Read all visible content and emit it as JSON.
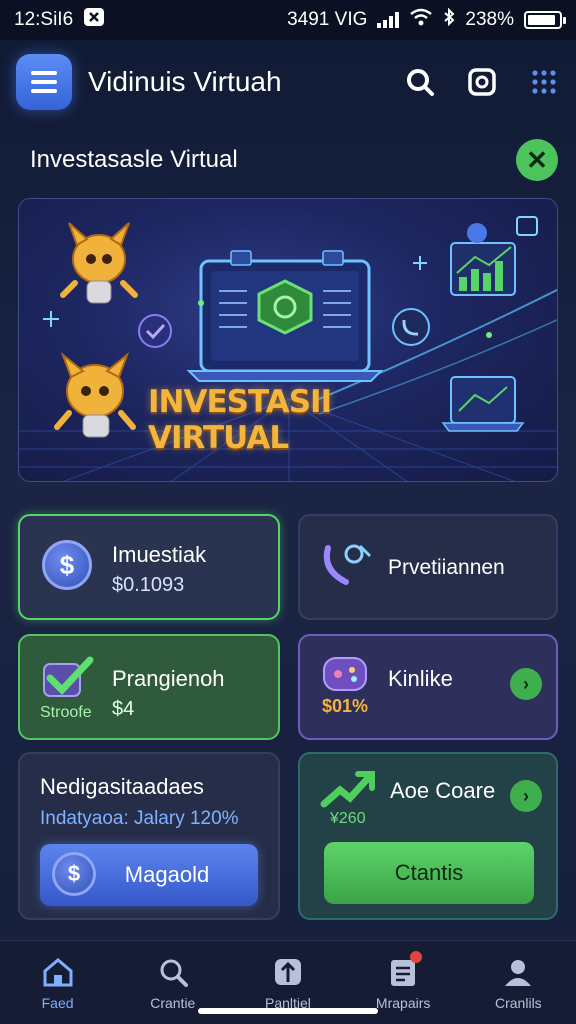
{
  "status": {
    "time": "12:SiI6",
    "network": "3491 VIG",
    "battery": "238%",
    "battery_level": 0.9
  },
  "appbar": {
    "title": "Vidinuis Virtuah",
    "icons": [
      "menu-icon",
      "search-icon",
      "camera-icon",
      "grid-icon"
    ]
  },
  "section": {
    "title": "Investasasle Virtual"
  },
  "banner": {
    "headline": "INVESTASII VIRTUAL"
  },
  "cards": {
    "investment": {
      "label": "Imuestiak",
      "value": "$0.1093"
    },
    "promo": {
      "label": "Prvetiiannen"
    },
    "progress": {
      "label": "Prangienoh",
      "sub": "Stroofe",
      "value": "$4"
    },
    "kinlike": {
      "label": "Kinlike",
      "value": "$01%"
    },
    "neg": {
      "label": "Nedigasitaadaes",
      "sub": "Indatyaoa: Jalary 120%",
      "button": "Magaold"
    },
    "core": {
      "label": "Aoe Coare",
      "value": "¥260",
      "button": "Ctantis"
    }
  },
  "nav": [
    {
      "label": "Faed",
      "icon": "home-icon",
      "active": true
    },
    {
      "label": "Crantie",
      "icon": "search-icon",
      "active": false
    },
    {
      "label": "Panltiel",
      "icon": "tag-icon",
      "active": false
    },
    {
      "label": "Mrapairs",
      "icon": "document-icon",
      "active": false
    },
    {
      "label": "Cranlils",
      "icon": "profile-icon",
      "active": false
    }
  ],
  "colors": {
    "accent_blue": "#4a78e8",
    "accent_green": "#4dc35b",
    "gold": "#f3b53b",
    "background": "#1b2445"
  }
}
